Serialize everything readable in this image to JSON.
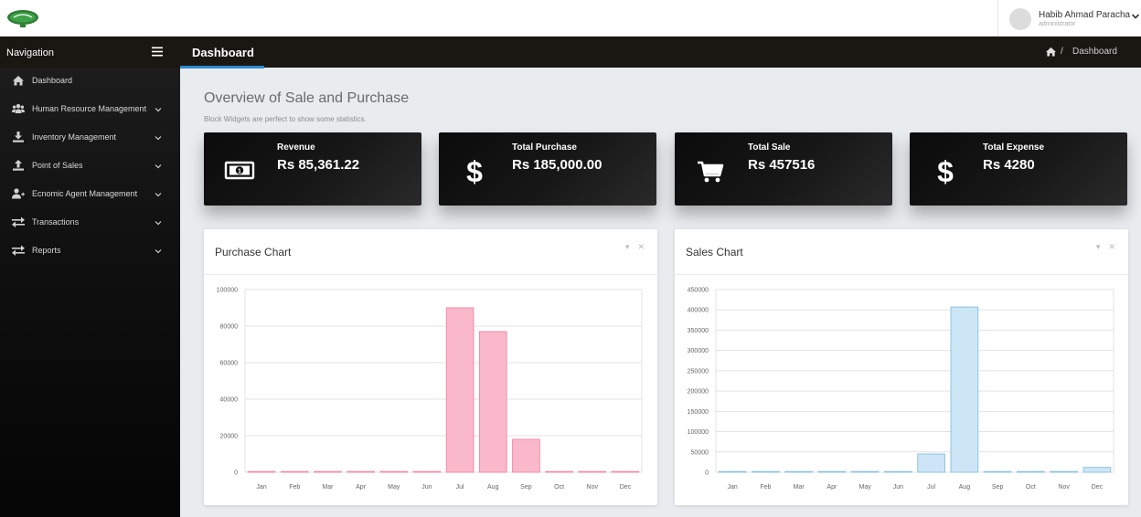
{
  "topbar": {
    "user_name": "Habib Ahmad Paracha",
    "user_role": "administrator"
  },
  "sidebar": {
    "title": "Navigation",
    "items": [
      {
        "label": "Dashboard",
        "icon": "home-icon",
        "has_children": false
      },
      {
        "label": "Human Resource Management",
        "icon": "users-icon",
        "has_children": true
      },
      {
        "label": "Inventory Management",
        "icon": "download-icon",
        "has_children": true
      },
      {
        "label": "Point of Sales",
        "icon": "upload-icon",
        "has_children": true
      },
      {
        "label": "Ecnomic Agent Management",
        "icon": "user-plus-icon",
        "has_children": true
      },
      {
        "label": "Transactions",
        "icon": "exchange-icon",
        "has_children": true
      },
      {
        "label": "Reports",
        "icon": "exchange-icon",
        "has_children": true
      }
    ]
  },
  "header": {
    "title": "Dashboard",
    "breadcrumb_sep": "/",
    "breadcrumb": "Dashboard"
  },
  "overview": {
    "title": "Overview of Sale and Purchase",
    "subtitle": "Block Widgets are perfect to show some statistics."
  },
  "stats": [
    {
      "label": "Revenue",
      "value": "Rs 85,361.22",
      "icon": "money-icon"
    },
    {
      "label": "Total Purchase",
      "value": "Rs 185,000.00",
      "icon": "dollar-icon"
    },
    {
      "label": "Total Sale",
      "value": "Rs 457516",
      "icon": "cart-icon"
    },
    {
      "label": "Total Expense",
      "value": "Rs 4280",
      "icon": "dollar-icon"
    }
  ],
  "cards": {
    "purchase_title": "Purchase Chart",
    "sales_title": "Sales Chart",
    "collapse_label": "▾",
    "close_label": "✕"
  },
  "colors": {
    "purchase_fill": "#f9b9cb",
    "purchase_stroke": "#f58aa8",
    "sales_fill": "#cde6f5",
    "sales_stroke": "#8cc4e6",
    "accent": "#2a8bd0"
  },
  "chart_data": [
    {
      "type": "bar",
      "title": "Purchase Chart",
      "categories": [
        "Jan",
        "Feb",
        "Mar",
        "Apr",
        "May",
        "Jun",
        "Jul",
        "Aug",
        "Sep",
        "Oct",
        "Nov",
        "Dec"
      ],
      "values": [
        0,
        0,
        0,
        0,
        0,
        0,
        90000,
        77000,
        18000,
        0,
        0,
        0
      ],
      "ylim": [
        0,
        100000
      ],
      "yticks": [
        0,
        20000,
        40000,
        60000,
        80000,
        100000
      ],
      "grid": true
    },
    {
      "type": "bar",
      "title": "Sales Chart",
      "categories": [
        "Jan",
        "Feb",
        "Mar",
        "Apr",
        "May",
        "Jun",
        "Jul",
        "Aug",
        "Sep",
        "Oct",
        "Nov",
        "Dec"
      ],
      "values": [
        0,
        0,
        0,
        0,
        0,
        0,
        45000,
        407000,
        0,
        0,
        0,
        12000
      ],
      "ylim": [
        0,
        450000
      ],
      "yticks": [
        0,
        50000,
        100000,
        150000,
        200000,
        250000,
        300000,
        350000,
        400000,
        450000
      ],
      "grid": true
    }
  ]
}
